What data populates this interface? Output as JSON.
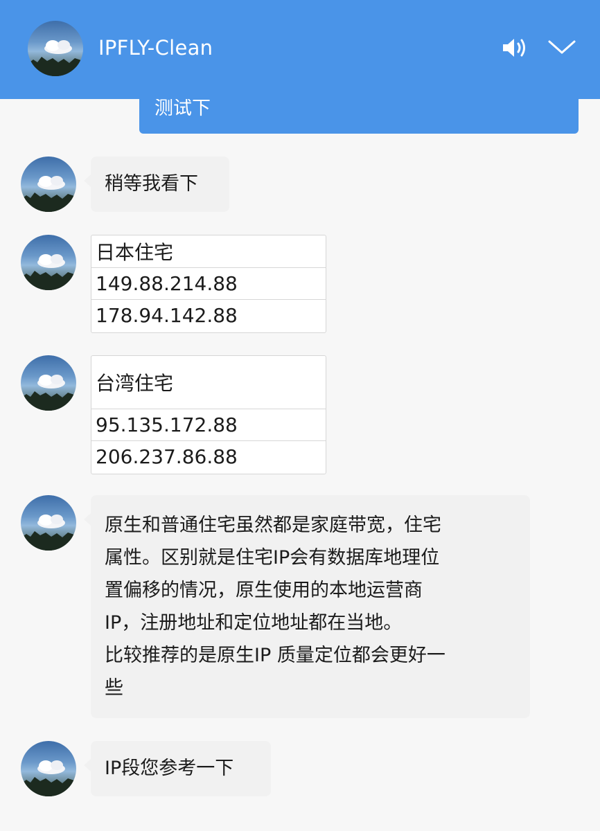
{
  "header": {
    "title": "IPFLY-Clean",
    "icons": [
      "avatar",
      "speaker-icon",
      "chevron-down-icon"
    ],
    "background": "#4a94e8"
  },
  "sent_message": {
    "text": "测试下"
  },
  "messages": [
    {
      "type": "text",
      "text": "稍等我看下"
    },
    {
      "type": "table",
      "rows": [
        "日本住宅",
        "149.88.214.88",
        "178.94.142.88"
      ]
    },
    {
      "type": "table",
      "rows": [
        "台湾住宅",
        "95.135.172.88",
        "206.237.86.88"
      ]
    },
    {
      "type": "text",
      "lines": [
        "原生和普通住宅虽然都是家庭带宽，住宅",
        "属性。区别就是住宅IP会有数据库地理位",
        "置偏移的情况，原生使用的本地运营商",
        "IP，注册地址和定位地址都在当地。",
        "比较推荐的是原生IP 质量定位都会更好一",
        "些"
      ]
    },
    {
      "type": "text",
      "text": "IP段您参考一下"
    }
  ]
}
